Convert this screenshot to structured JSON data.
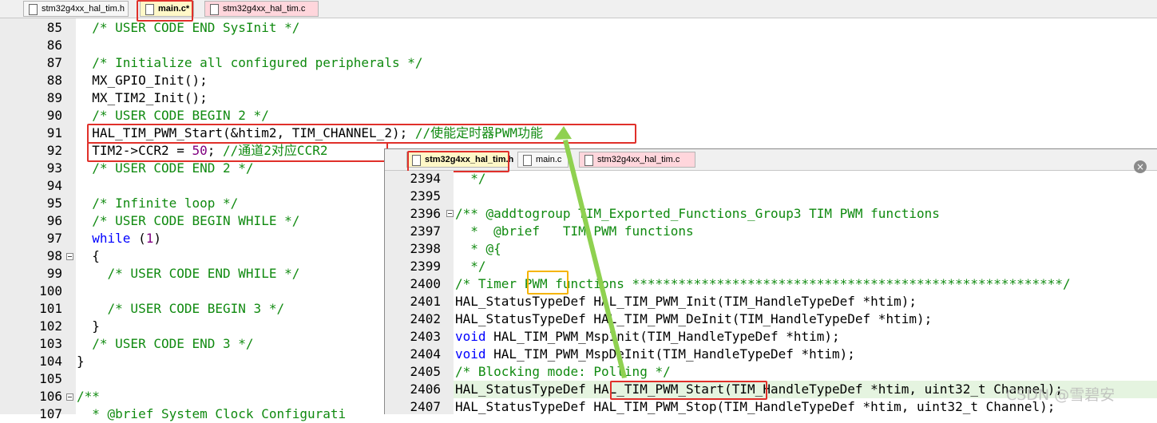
{
  "main_editor": {
    "tabs": [
      {
        "label": "stm32g4xx_hal_tim.h",
        "state": "normal"
      },
      {
        "label": "main.c*",
        "state": "active"
      },
      {
        "label": "stm32g4xx_hal_tim.c",
        "state": "modified"
      }
    ],
    "lines": [
      {
        "num": "85",
        "text": "  /* USER CODE END SysInit */"
      },
      {
        "num": "86",
        "text": ""
      },
      {
        "num": "87",
        "text": "  /* Initialize all configured peripherals */"
      },
      {
        "num": "88",
        "text": "  MX_GPIO_Init();"
      },
      {
        "num": "89",
        "text": "  MX_TIM2_Init();"
      },
      {
        "num": "90",
        "text": "  /* USER CODE BEGIN 2 */"
      },
      {
        "num": "91",
        "text": "  HAL_TIM_PWM_Start(&htim2, TIM_CHANNEL_2); //使能定时器PWM功能"
      },
      {
        "num": "92",
        "text": "  TIM2->CCR2 = 50; //通道2对应CCR2"
      },
      {
        "num": "93",
        "text": "  /* USER CODE END 2 */"
      },
      {
        "num": "94",
        "text": ""
      },
      {
        "num": "95",
        "text": "  /* Infinite loop */"
      },
      {
        "num": "96",
        "text": "  /* USER CODE BEGIN WHILE */"
      },
      {
        "num": "97",
        "text": "  while (1)"
      },
      {
        "num": "98",
        "text": "  {"
      },
      {
        "num": "99",
        "text": "    /* USER CODE END WHILE */"
      },
      {
        "num": "100",
        "text": ""
      },
      {
        "num": "101",
        "text": "    /* USER CODE BEGIN 3 */"
      },
      {
        "num": "102",
        "text": "  }"
      },
      {
        "num": "103",
        "text": "  /* USER CODE END 3 */"
      },
      {
        "num": "104",
        "text": "}"
      },
      {
        "num": "105",
        "text": ""
      },
      {
        "num": "106",
        "text": "/**"
      },
      {
        "num": "107",
        "text": "  * @brief System Clock Configurati"
      }
    ]
  },
  "header_editor": {
    "tabs": [
      {
        "label": "stm32g4xx_hal_tim.h",
        "state": "active"
      },
      {
        "label": "main.c",
        "state": "normal"
      },
      {
        "label": "stm32g4xx_hal_tim.c",
        "state": "modified"
      }
    ],
    "lines": [
      {
        "num": "2394",
        "text": "  */"
      },
      {
        "num": "2395",
        "text": ""
      },
      {
        "num": "2396",
        "text": "/** @addtogroup TIM_Exported_Functions_Group3 TIM PWM functions"
      },
      {
        "num": "2397",
        "text": "  *  @brief   TIM PWM functions"
      },
      {
        "num": "2398",
        "text": "  * @{"
      },
      {
        "num": "2399",
        "text": "  */"
      },
      {
        "num": "2400",
        "text": "/* Timer PWM functions ********************************************************/"
      },
      {
        "num": "2401",
        "text": "HAL_StatusTypeDef HAL_TIM_PWM_Init(TIM_HandleTypeDef *htim);"
      },
      {
        "num": "2402",
        "text": "HAL_StatusTypeDef HAL_TIM_PWM_DeInit(TIM_HandleTypeDef *htim);"
      },
      {
        "num": "2403",
        "text": "void HAL_TIM_PWM_MspInit(TIM_HandleTypeDef *htim);"
      },
      {
        "num": "2404",
        "text": "void HAL_TIM_PWM_MspDeInit(TIM_HandleTypeDef *htim);"
      },
      {
        "num": "2405",
        "text": "/* Blocking mode: Polling */"
      },
      {
        "num": "2406",
        "text": "HAL_StatusTypeDef HAL_TIM_PWM_Start(TIM_HandleTypeDef *htim, uint32_t Channel);"
      },
      {
        "num": "2407",
        "text": "HAL_StatusTypeDef HAL_TIM_PWM_Stop(TIM_HandleTypeDef *htim, uint32_t Channel);"
      }
    ],
    "close_label": "×"
  },
  "watermark": "CSDN @雪碧安",
  "colors": {
    "comment": "#108a10",
    "keyword": "#0000ff",
    "number": "#800080",
    "annotation_red": "#e0302a",
    "annotation_orange": "#f5b400",
    "arrow_green": "#8fd150",
    "highlight_line": "#e5f4e0"
  }
}
